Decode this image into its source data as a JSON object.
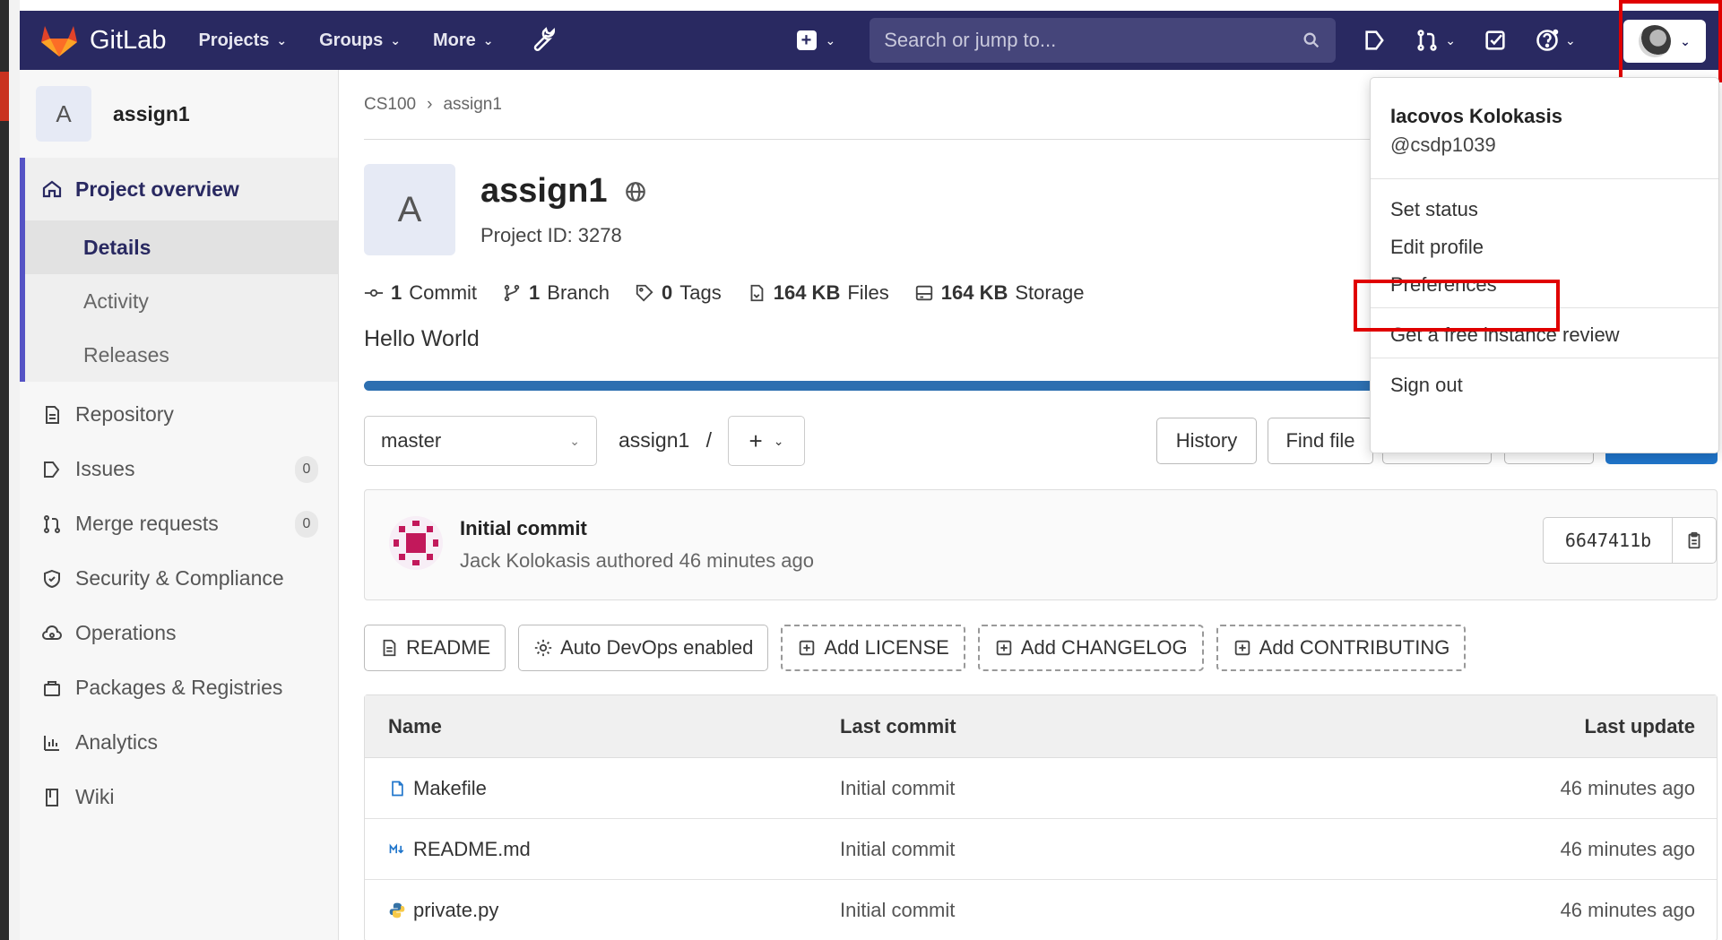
{
  "navbar": {
    "brand": "GitLab",
    "menus": [
      "Projects",
      "Groups",
      "More"
    ],
    "search_placeholder": "Search or jump to..."
  },
  "sidebar": {
    "project_initial": "A",
    "project_name": "assign1",
    "overview": {
      "label": "Project overview",
      "sub": [
        "Details",
        "Activity",
        "Releases"
      ]
    },
    "items": [
      {
        "label": "Repository",
        "icon": "doc-icon"
      },
      {
        "label": "Issues",
        "icon": "issues-icon",
        "count": "0"
      },
      {
        "label": "Merge requests",
        "icon": "merge-icon",
        "count": "0"
      },
      {
        "label": "Security & Compliance",
        "icon": "shield-icon"
      },
      {
        "label": "Operations",
        "icon": "cloud-icon"
      },
      {
        "label": "Packages & Registries",
        "icon": "package-icon"
      },
      {
        "label": "Analytics",
        "icon": "chart-icon"
      },
      {
        "label": "Wiki",
        "icon": "book-icon"
      }
    ]
  },
  "breadcrumb": [
    "CS100",
    "assign1"
  ],
  "project": {
    "initial": "A",
    "title": "assign1",
    "id_text": "Project ID: 3278",
    "stats": [
      {
        "num": "1",
        "label": "Commit"
      },
      {
        "num": "1",
        "label": "Branch"
      },
      {
        "num": "0",
        "label": "Tags"
      },
      {
        "num": "164 KB",
        "label": "Files"
      },
      {
        "num": "164 KB",
        "label": "Storage"
      }
    ],
    "description": "Hello World",
    "progress_fraction": 1.0
  },
  "repo_toolbar": {
    "branch": "master",
    "path": "assign1",
    "path_sep": "/",
    "history": "History",
    "find_file": "Find file"
  },
  "commit": {
    "title": "Initial commit",
    "meta": "Jack Kolokasis authored 46 minutes ago",
    "sha": "6647411b"
  },
  "actions": [
    {
      "label": "README",
      "style": "solid"
    },
    {
      "label": "Auto DevOps enabled",
      "style": "solid"
    },
    {
      "label": "Add LICENSE",
      "style": "dashed"
    },
    {
      "label": "Add CHANGELOG",
      "style": "dashed"
    },
    {
      "label": "Add CONTRIBUTING",
      "style": "dashed"
    }
  ],
  "table": {
    "headers": {
      "name": "Name",
      "commit": "Last commit",
      "update": "Last update"
    },
    "rows": [
      {
        "name": "Makefile",
        "commit": "Initial commit",
        "update": "46 minutes ago",
        "icon": "file-icon"
      },
      {
        "name": "README.md",
        "commit": "Initial commit",
        "update": "46 minutes ago",
        "icon": "markdown-icon"
      },
      {
        "name": "private.py",
        "commit": "Initial commit",
        "update": "46 minutes ago",
        "icon": "python-icon"
      }
    ]
  },
  "user_menu": {
    "name": "Iacovos Kolokasis",
    "handle": "@csdp1039",
    "items": [
      "Set status",
      "Edit profile",
      "Preferences",
      "Get a free instance review",
      "Sign out"
    ]
  },
  "colors": {
    "navbar": "#292961",
    "accent": "#5553c5",
    "highlight": "#e00000",
    "progress": "#2d6fb0"
  }
}
